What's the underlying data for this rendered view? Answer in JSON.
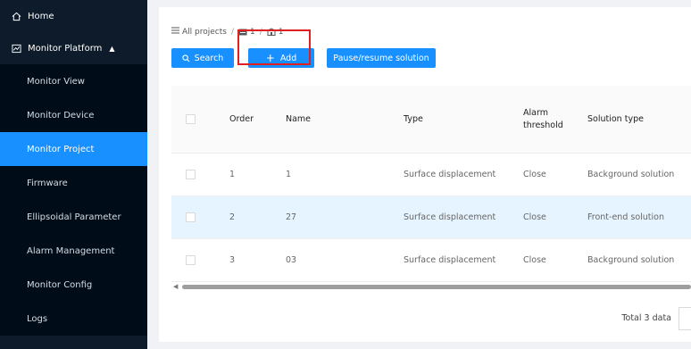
{
  "sidebar": {
    "home": "Home",
    "monitor_platform": "Monitor Platform",
    "items": [
      {
        "label": "Monitor View"
      },
      {
        "label": "Monitor Device"
      },
      {
        "label": "Monitor Project"
      },
      {
        "label": "Firmware"
      },
      {
        "label": "Ellipsoidal Parameter"
      },
      {
        "label": "Alarm Management"
      },
      {
        "label": "Monitor Config"
      },
      {
        "label": "Logs"
      }
    ],
    "active": "Monitor Project"
  },
  "breadcrumb": {
    "root": "All projects",
    "level1": "1",
    "level2": "1"
  },
  "toolbar": {
    "search": "Search",
    "add": "Add",
    "pause": "Pause/resume solution"
  },
  "table": {
    "headers": {
      "order": "Order",
      "name": "Name",
      "type": "Type",
      "alarm": "Alarm threshold",
      "solution": "Solution type"
    },
    "rows": [
      {
        "order": "1",
        "name": "1",
        "type": "Surface displacement",
        "alarm": "Close",
        "solution": "Background solution"
      },
      {
        "order": "2",
        "name": "27",
        "type": "Surface displacement",
        "alarm": "Close",
        "solution": "Front-end solution"
      },
      {
        "order": "3",
        "name": "03",
        "type": "Surface displacement",
        "alarm": "Close",
        "solution": "Background solution"
      }
    ]
  },
  "footer": {
    "total": "Total 3 data"
  },
  "colors": {
    "sidebar_bg": "#0d1b2a",
    "accent": "#1890ff",
    "highlight_row": "#e6f4ff",
    "annotation": "#e02020"
  }
}
